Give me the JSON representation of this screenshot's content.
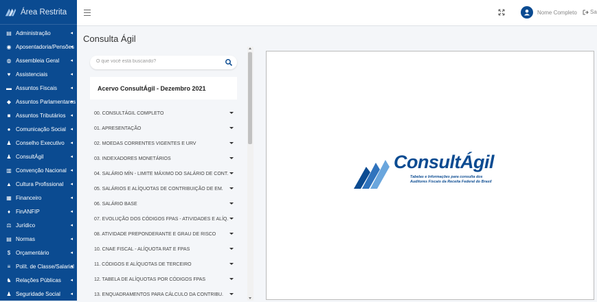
{
  "sidebar": {
    "brand_title": "Área Restrita",
    "items": [
      {
        "label": "Administração",
        "icon": "id-card-icon"
      },
      {
        "label": "Aposentadoria/Pensões",
        "icon": "user-search-icon"
      },
      {
        "label": "Assembleia Geral",
        "icon": "users-icon"
      },
      {
        "label": "Assistenciais",
        "icon": "heart-icon"
      },
      {
        "label": "Assuntos Fiscais",
        "icon": "wallet-icon"
      },
      {
        "label": "Assuntos Parlamentares",
        "icon": "handshake-icon"
      },
      {
        "label": "Assuntos Tributários",
        "icon": "briefcase-icon"
      },
      {
        "label": "Comunicação Social",
        "icon": "chat-icon"
      },
      {
        "label": "Conselho Executivo",
        "icon": "user-tie-icon"
      },
      {
        "label": "ConsultÁgil",
        "icon": "user-check-icon"
      },
      {
        "label": "Convenção Nacional",
        "icon": "landmark-icon"
      },
      {
        "label": "Cultura Profissional",
        "icon": "thumbs-up-icon"
      },
      {
        "label": "Financeiro",
        "icon": "building-icon"
      },
      {
        "label": "FinANFIP",
        "icon": "hand-dollar-icon"
      },
      {
        "label": "Jurídico",
        "icon": "scale-icon"
      },
      {
        "label": "Normas",
        "icon": "list-icon"
      },
      {
        "label": "Orçamentário",
        "icon": "dollar-icon"
      },
      {
        "label": "Polít. de Classe/Salarial",
        "icon": "align-icon"
      },
      {
        "label": "Relações Públicas",
        "icon": "chess-icon"
      },
      {
        "label": "Seguridade Social",
        "icon": "user-gear-icon"
      }
    ]
  },
  "topbar": {
    "user_name": "Nome Completo",
    "logout_label": "Sair"
  },
  "page": {
    "title": "Consulta Ágil"
  },
  "search": {
    "placeholder": "O que você está buscando?"
  },
  "acervo": {
    "title": "Acervo ConsultÁgil - Dezembro 2021"
  },
  "menu": [
    "00. CONSULTÁGIL COMPLETO",
    "01. APRESENTAÇÃO",
    "02. MOEDAS CORRENTES VIGENTES E URV",
    "03. INDEXADORES MONETÁRIOS",
    "04. SALÁRIO MÍN - LIMITE MÁXIMO DO SALÁRIO DE CONT.",
    "05. SALÁRIOS E ALÍQUOTAS DE CONTRIBUIÇÃO DE EM.",
    "06. SALÁRIO BASE",
    "07. EVOLUÇÃO DOS CÓDIGOS FPAS - ATIVIDADES E ALÍQ.",
    "08. ATIVIDADE PREPONDERANTE E GRAU DE RISCO",
    "10. CNAE FISCAL - ALÍQUOTA RAT E FPAS",
    "11. CÓDIGOS E ALÍQUOTAS DE TERCEIRO",
    "12. TABELA DE ALÍQUOTAS POR CÓDIGOS FPAS",
    "13. ENQUADRAMENTOS PARA CÁLCULO DA CONTRIBU."
  ],
  "viewer": {
    "logo_name": "ConsultÁgil",
    "logo_tagline_1": "Tabelas e Informações para consulta dos",
    "logo_tagline_2": "Auditores Fiscais da Receita Federal do Brasil"
  },
  "colors": {
    "sidebar_bg": "#0b4b91",
    "accent": "#0b4b91"
  }
}
